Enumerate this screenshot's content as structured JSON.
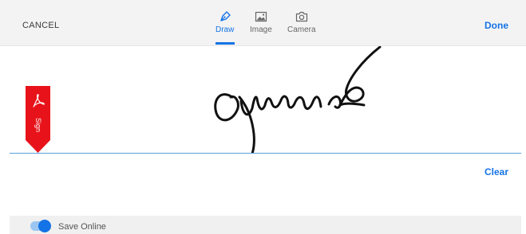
{
  "header": {
    "cancel_label": "CANCEL",
    "done_label": "Done",
    "tabs": [
      {
        "label": "Draw",
        "icon": "pen-icon",
        "active": true
      },
      {
        "label": "Image",
        "icon": "image-icon",
        "active": false
      },
      {
        "label": "Camera",
        "icon": "camera-icon",
        "active": false
      }
    ]
  },
  "canvas": {
    "ribbon_label": "Sign",
    "ribbon_icon": "acrobat-logo-icon",
    "clear_label": "Clear"
  },
  "footer": {
    "save_online_label": "Save Online",
    "save_online_enabled": true
  },
  "colors": {
    "accent": "#1473e6",
    "ribbon": "#e8131a",
    "baseline": "#5a9fd8",
    "toggle_track": "#9cc6f2"
  }
}
